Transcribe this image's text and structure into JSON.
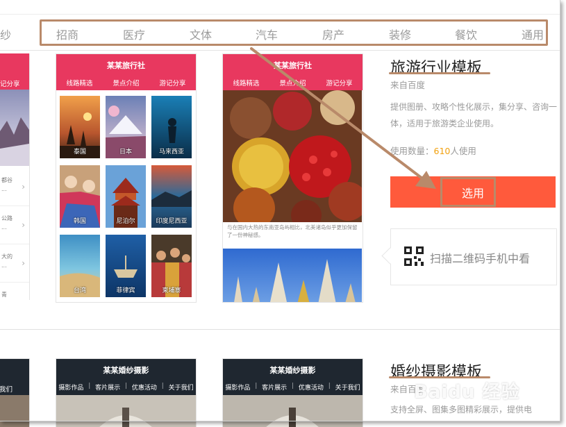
{
  "nav": {
    "cut_left": "纱",
    "items": [
      "招商",
      "医疗",
      "文体",
      "汽车",
      "房产",
      "装修",
      "餐饮",
      "通用"
    ]
  },
  "left_partial": {
    "tab": "记分享",
    "rows": [
      "都谷",
      "公路",
      "大的",
      "青"
    ]
  },
  "travel_preview_1": {
    "title": "某某旅行社",
    "tabs": [
      "线路精选",
      "景点介绍",
      "游记分享"
    ],
    "tiles": [
      "泰国",
      "日本",
      "马来西亚",
      "韩国",
      "尼泊尔",
      "印度尼西亚",
      "台湾",
      "菲律宾",
      "柬埔寨"
    ]
  },
  "travel_preview_2": {
    "title": "某某旅行社",
    "tabs": [
      "线路精选",
      "景点介绍",
      "游记分享"
    ],
    "caption": "与在国内大热的东南亚岛屿相比，北美诸岛似乎更加保留了一份神秘感。"
  },
  "travel_template": {
    "title": "旅游行业模板",
    "source": "来自百度",
    "description": "提供图册、攻略个性化展示，集分享、咨询一体，适用于旅游类企业使用。",
    "usage_prefix": "使用数量：",
    "usage_count": "610",
    "usage_suffix": "人使用",
    "select_label": "选用",
    "qr_text": "扫描二维码手机中看"
  },
  "wedding_preview_1": {
    "title": "某某婚纱摄影",
    "tabs": [
      "摄影作品",
      "客片展示",
      "优惠活动",
      "关于我们"
    ]
  },
  "wedding_preview_2": {
    "title": "某某婚纱摄影",
    "tabs": [
      "摄影作品",
      "客片展示",
      "优惠活动",
      "关于我们"
    ]
  },
  "wedding_left_tab": "关于我们",
  "wedding_template": {
    "title": "婚纱摄影模板",
    "source": "来自百度",
    "description": "支持全屏、图集多图精彩展示，提供电"
  },
  "watermark": "Baidu 经验",
  "colors": {
    "accent_red": "#e8385f",
    "button_orange": "#ff5a3c",
    "annotation_brown": "#b98a6a",
    "usage_orange": "#f2a10f",
    "dark_header": "#1f2730"
  }
}
